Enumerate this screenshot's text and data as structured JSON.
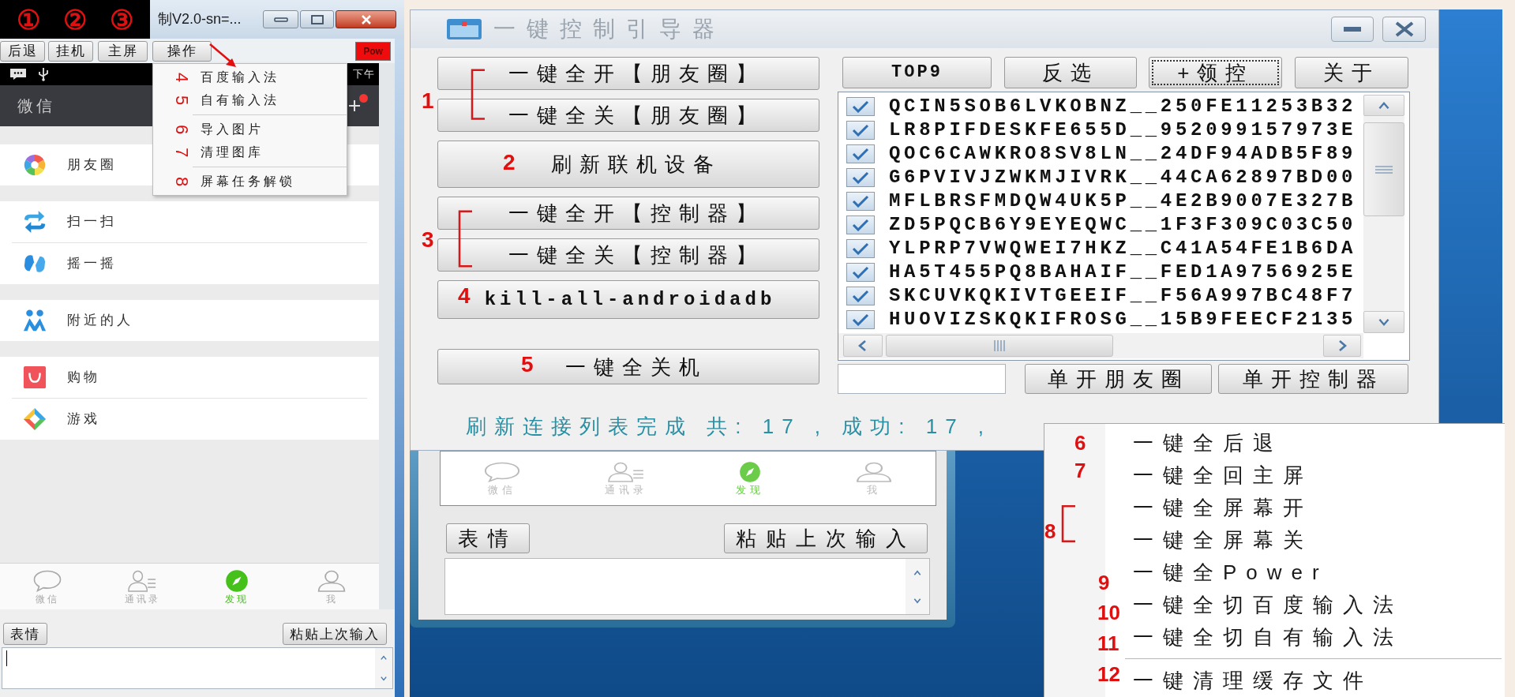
{
  "annotation_marks": [
    "①",
    "②",
    "③"
  ],
  "phone_window": {
    "title": "制V2.0-sn=...",
    "toolbar": [
      "后退",
      "挂机",
      "主屏",
      "操作"
    ],
    "power_button": "Pow",
    "status_time": "下午",
    "app_title": "微信",
    "operation_menu": [
      [
        {
          "tag": "4",
          "label": "百度输入法"
        },
        {
          "tag": "5",
          "label": "自有输入法"
        }
      ],
      [
        {
          "tag": "6",
          "label": "导入图片"
        },
        {
          "tag": "7",
          "label": "清理图库"
        }
      ],
      [
        {
          "tag": "8",
          "label": "屏幕任务解锁"
        }
      ]
    ],
    "discover_sections": [
      [
        {
          "kind": "moments",
          "label": "朋友圈"
        }
      ],
      [
        {
          "kind": "scan",
          "label": "扫一扫"
        },
        {
          "kind": "shake",
          "label": "摇一摇"
        }
      ],
      [
        {
          "kind": "nearby",
          "label": "附近的人"
        }
      ],
      [
        {
          "kind": "shopping",
          "label": "购物"
        },
        {
          "kind": "games",
          "label": "游戏"
        }
      ]
    ],
    "tabs": [
      {
        "kind": "chats",
        "label": "微信",
        "selected": false
      },
      {
        "kind": "contacts",
        "label": "通讯录",
        "selected": false
      },
      {
        "kind": "discover",
        "label": "发现",
        "selected": true
      },
      {
        "kind": "me",
        "label": "我",
        "selected": false
      }
    ],
    "input_buttons": [
      "表情",
      "粘贴上次输入"
    ]
  },
  "control_dialog": {
    "title": "一键控制引导器",
    "action_groups": [
      {
        "tag": "1",
        "buttons": [
          "一键全开【朋友圈】",
          "一键全关【朋友圈】"
        ]
      },
      {
        "tag": "2",
        "buttons": [
          "刷新联机设备"
        ]
      },
      {
        "tag": "3",
        "buttons": [
          "一键全开【控制器】",
          "一键全关【控制器】"
        ]
      },
      {
        "tag": "4",
        "buttons": [
          "kill-all-androidadb"
        ]
      },
      {
        "tag": "5",
        "buttons": [
          "一键全关机"
        ]
      }
    ],
    "list_buttons": [
      {
        "label": "TOP9",
        "focused": false
      },
      {
        "label": "反选",
        "focused": false
      },
      {
        "label": "+领控",
        "focused": true
      },
      {
        "label": "关于",
        "focused": false
      }
    ],
    "devices": [
      {
        "name": "QCIN5SOB6LVKOBNZ__250FE11253B32",
        "checked": true
      },
      {
        "name": "LR8PIFDESKFE655D__952099157973E",
        "checked": true
      },
      {
        "name": "QOC6CAWKRO8SV8LN__24DF94ADB5F89",
        "checked": true
      },
      {
        "name": "G6PVIVJZWKMJIVRK__44CA62897BD00",
        "checked": true
      },
      {
        "name": "MFLBRSFMDQW4UK5P__4E2B9007E327B",
        "checked": true
      },
      {
        "name": "ZD5PQCB6Y9EYEQWC__1F3F309C03C50",
        "checked": true
      },
      {
        "name": "YLPRP7VWQWEI7HKZ__C41A54FE1B6DA",
        "checked": true
      },
      {
        "name": "HA5T455PQ8BAHAIF__FED1A9756925E",
        "checked": true
      },
      {
        "name": "SKCUVKQKIVTGEEIF__F56A997BC48F7",
        "checked": true
      },
      {
        "name": "HUOVIZSKQKIFROSG__15B9FEECF2135",
        "checked": true
      }
    ],
    "single_buttons": [
      "单开朋友圈",
      "单开控制器"
    ],
    "status": "刷新连接列表完成 共: 17 , 成功: 17 ,"
  },
  "background_window": {
    "tabs": [
      {
        "kind": "chats",
        "label": "微信",
        "selected": false
      },
      {
        "kind": "contacts",
        "label": "通讯录",
        "selected": false
      },
      {
        "kind": "discover",
        "label": "发现",
        "selected": true
      },
      {
        "kind": "me",
        "label": "我",
        "selected": false
      }
    ],
    "input_buttons": [
      "表情",
      "粘贴上次输入"
    ]
  },
  "batch_menu": [
    [
      {
        "tag": "6",
        "items": [
          "一键全后退"
        ]
      },
      {
        "tag": "7",
        "items": [
          "一键全回主屏"
        ]
      },
      {
        "tag": "8",
        "items": [
          "一键全屏幕开",
          "一键全屏幕关"
        ]
      },
      {
        "tag": "9",
        "items": [
          "一键全Power"
        ]
      },
      {
        "tag": "10",
        "items": [
          "一键全切百度输入法"
        ]
      },
      {
        "tag": "11",
        "items": [
          "一键全切自有输入法"
        ]
      }
    ],
    [
      {
        "tag": "12",
        "items": [
          "一键清理缓存文件"
        ]
      }
    ]
  ]
}
